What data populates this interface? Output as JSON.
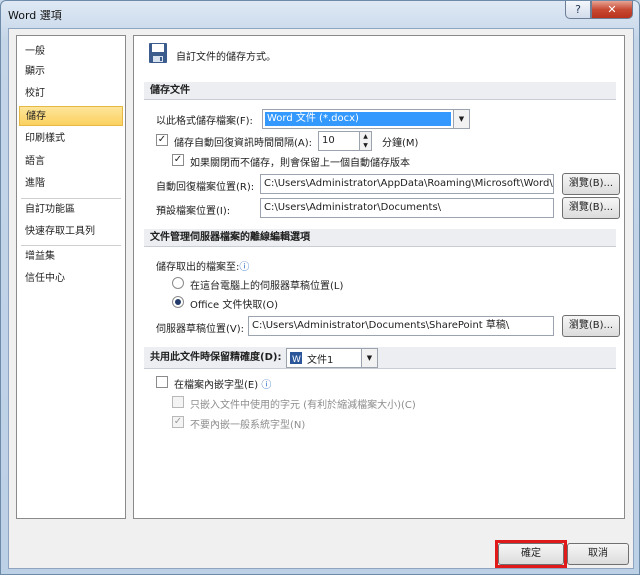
{
  "window": {
    "title": "Word 選項",
    "help_icon": "?",
    "close_icon": "✕"
  },
  "sidebar": {
    "items": [
      {
        "label": "一般"
      },
      {
        "label": "顯示"
      },
      {
        "label": "校訂"
      },
      {
        "label": "儲存",
        "selected": true
      },
      {
        "label": "印刷樣式"
      },
      {
        "label": "語言"
      },
      {
        "label": "進階"
      },
      {
        "label": "自訂功能區"
      },
      {
        "label": "快速存取工具列"
      },
      {
        "label": "增益集"
      },
      {
        "label": "信任中心"
      }
    ]
  },
  "header": {
    "icon": "floppy-disk-icon",
    "text": "自訂文件的儲存方式。"
  },
  "save_docs": {
    "title": "儲存文件",
    "format_label": "以此格式儲存檔案(F):",
    "format_value": "Word 文件 (*.docx)",
    "autorecover_label": "儲存自動回復資訊時間間隔(A):",
    "autorecover_checked": true,
    "interval_value": "10",
    "minutes_label": "分鐘(M)",
    "keep_last_label": "如果關閉而不儲存，則會保留上一個自動儲存版本",
    "keep_last_checked": true,
    "autorecover_loc_label": "自動回復檔案位置(R):",
    "autorecover_loc_value": "C:\\Users\\Administrator\\AppData\\Roaming\\Microsoft\\Word\\",
    "browse1_label": "瀏覽(B)...",
    "default_loc_label": "預設檔案位置(I):",
    "default_loc_value": "C:\\Users\\Administrator\\Documents\\",
    "browse2_label": "瀏覽(B)..."
  },
  "offline": {
    "title": "文件管理伺服器檔案的離線編輯選項",
    "save_checked_out_label": "儲存取出的檔案至:",
    "info_icon": "ⓘ",
    "option_local_label": "在這台電腦上的伺服器草稿位置(L)",
    "option_local_selected": false,
    "option_cache_label": "Office 文件快取(O)",
    "option_cache_selected": true,
    "drafts_loc_label": "伺服器草稿位置(V):",
    "drafts_loc_value": "C:\\Users\\Administrator\\Documents\\SharePoint 草稿\\",
    "browse3_label": "瀏覽(B)..."
  },
  "fidelity": {
    "title": "共用此文件時保留精確度(D):",
    "doc_value": "文件1",
    "embed_fonts_label": "在檔案內嵌字型(E)",
    "embed_fonts_checked": false,
    "embed_only_used_label": "只嵌入文件中使用的字元 (有利於縮減檔案大小)(C)",
    "embed_only_used_checked": false,
    "no_common_fonts_label": "不要內嵌一般系統字型(N)",
    "no_common_fonts_checked": true
  },
  "footer": {
    "ok_label": "確定",
    "cancel_label": "取消"
  },
  "colors": {
    "selected_highlight": "#3399ff",
    "active_sidebar": "#fbd160",
    "annotation_red": "#e01a1a"
  }
}
